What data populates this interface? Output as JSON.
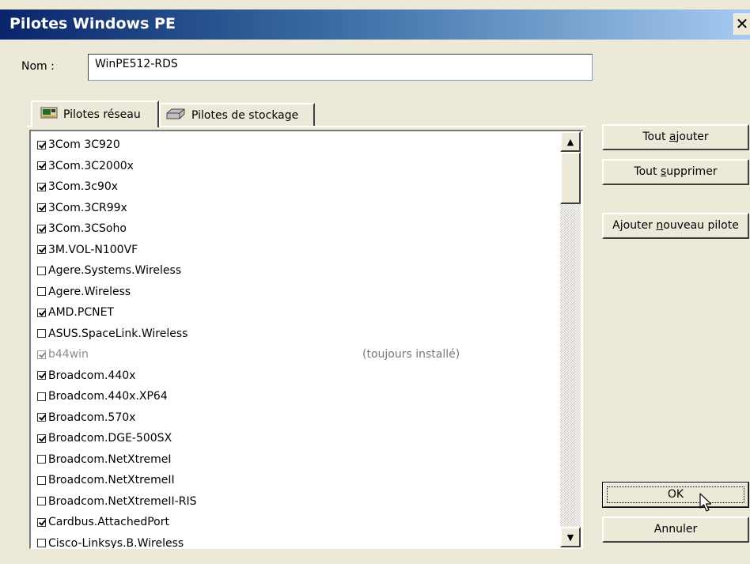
{
  "window": {
    "title": "Pilotes Windows PE",
    "close_glyph": "✕"
  },
  "name_field": {
    "label": "Nom :",
    "value": "WinPE512-RDS"
  },
  "tabs": [
    {
      "label": "Pilotes réseau",
      "icon": "network-card-icon",
      "active": true
    },
    {
      "label": "Pilotes de stockage",
      "icon": "disk-drive-icon",
      "active": false
    }
  ],
  "drivers": [
    {
      "label": "3Com 3C920",
      "checked": true
    },
    {
      "label": "3Com.3C2000x",
      "checked": true
    },
    {
      "label": "3Com.3c90x",
      "checked": true
    },
    {
      "label": "3Com.3CR99x",
      "checked": true
    },
    {
      "label": "3Com.3CSoho",
      "checked": true
    },
    {
      "label": "3M.VOL-N100VF",
      "checked": true
    },
    {
      "label": "Agere.Systems.Wireless",
      "checked": false
    },
    {
      "label": "Agere.Wireless",
      "checked": false
    },
    {
      "label": "AMD.PCNET",
      "checked": true
    },
    {
      "label": "ASUS.SpaceLink.Wireless",
      "checked": false
    },
    {
      "label": "b44win",
      "checked": true,
      "disabled": true,
      "note": "(toujours installé)"
    },
    {
      "label": "Broadcom.440x",
      "checked": true
    },
    {
      "label": "Broadcom.440x.XP64",
      "checked": false
    },
    {
      "label": "Broadcom.570x",
      "checked": true
    },
    {
      "label": "Broadcom.DGE-500SX",
      "checked": true
    },
    {
      "label": "Broadcom.NetXtremeI",
      "checked": false
    },
    {
      "label": "Broadcom.NetXtremeII",
      "checked": false
    },
    {
      "label": "Broadcom.NetXtremeII-RIS",
      "checked": false
    },
    {
      "label": "Cardbus.AttachedPort",
      "checked": true
    },
    {
      "label": "Cisco-Linksys.B.Wireless",
      "checked": false
    }
  ],
  "buttons": {
    "add_all": {
      "before": "Tout ",
      "mnemonic": "a",
      "after": "jouter"
    },
    "remove_all": {
      "before": "Tout ",
      "mnemonic": "s",
      "after": "upprimer"
    },
    "add_new": {
      "before": "Ajouter ",
      "mnemonic": "n",
      "after": "ouveau pilote"
    },
    "ok": "OK",
    "cancel": "Annuler"
  },
  "scrollbar": {
    "up_glyph": "▲",
    "down_glyph": "▼"
  }
}
